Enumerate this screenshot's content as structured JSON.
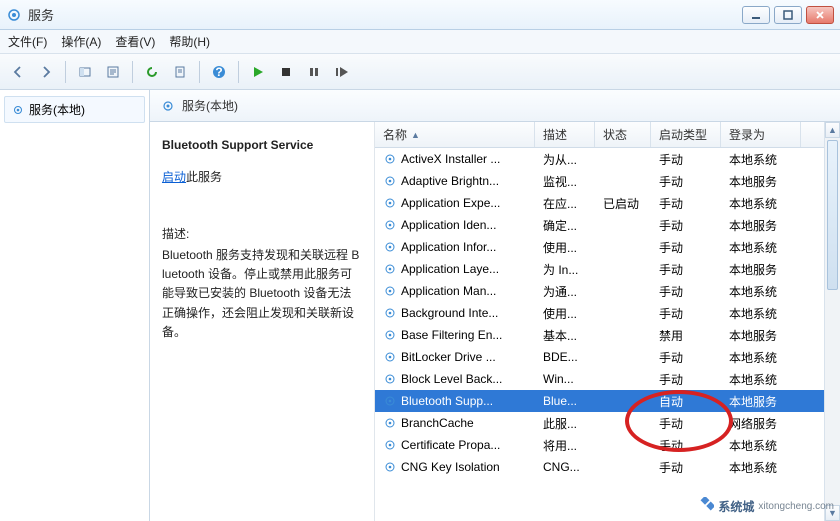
{
  "window_title": "服务",
  "menu": {
    "file": "文件(F)",
    "action": "操作(A)",
    "view": "查看(V)",
    "help": "帮助(H)"
  },
  "tree": {
    "root": "服务(本地)"
  },
  "righthead": "服务(本地)",
  "detail": {
    "title": "Bluetooth Support Service",
    "start_link": "启动",
    "start_tail": "此服务",
    "desc_label": "描述:",
    "desc_text": "Bluetooth 服务支持发现和关联远程 Bluetooth 设备。停止或禁用此服务可能导致已安装的 Bluetooth 设备无法正确操作，还会阻止发现和关联新设备。"
  },
  "columns": {
    "name": "名称",
    "desc": "描述",
    "status": "状态",
    "startup": "启动类型",
    "logon": "登录为"
  },
  "rows": [
    {
      "name": "ActiveX Installer ...",
      "desc": "为从...",
      "status": "",
      "startup": "手动",
      "logon": "本地系统"
    },
    {
      "name": "Adaptive Brightn...",
      "desc": "监视...",
      "status": "",
      "startup": "手动",
      "logon": "本地服务"
    },
    {
      "name": "Application Expe...",
      "desc": "在应...",
      "status": "已启动",
      "startup": "手动",
      "logon": "本地系统"
    },
    {
      "name": "Application Iden...",
      "desc": "确定...",
      "status": "",
      "startup": "手动",
      "logon": "本地服务"
    },
    {
      "name": "Application Infor...",
      "desc": "使用...",
      "status": "",
      "startup": "手动",
      "logon": "本地系统"
    },
    {
      "name": "Application Laye...",
      "desc": "为 In...",
      "status": "",
      "startup": "手动",
      "logon": "本地服务"
    },
    {
      "name": "Application Man...",
      "desc": "为通...",
      "status": "",
      "startup": "手动",
      "logon": "本地系统"
    },
    {
      "name": "Background Inte...",
      "desc": "使用...",
      "status": "",
      "startup": "手动",
      "logon": "本地系统"
    },
    {
      "name": "Base Filtering En...",
      "desc": "基本...",
      "status": "",
      "startup": "禁用",
      "logon": "本地服务"
    },
    {
      "name": "BitLocker Drive ...",
      "desc": "BDE...",
      "status": "",
      "startup": "手动",
      "logon": "本地系统"
    },
    {
      "name": "Block Level Back...",
      "desc": "Win...",
      "status": "",
      "startup": "手动",
      "logon": "本地系统"
    },
    {
      "name": "Bluetooth Supp...",
      "desc": "Blue...",
      "status": "",
      "startup": "自动",
      "logon": "本地服务",
      "selected": true
    },
    {
      "name": "BranchCache",
      "desc": "此服...",
      "status": "",
      "startup": "手动",
      "logon": "网络服务"
    },
    {
      "name": "Certificate Propa...",
      "desc": "将用...",
      "status": "",
      "startup": "手动",
      "logon": "本地系统"
    },
    {
      "name": "CNG Key Isolation",
      "desc": "CNG...",
      "status": "",
      "startup": "手动",
      "logon": "本地系统"
    }
  ],
  "watermark": "系统城",
  "watermark_sub": "xitongcheng.com"
}
